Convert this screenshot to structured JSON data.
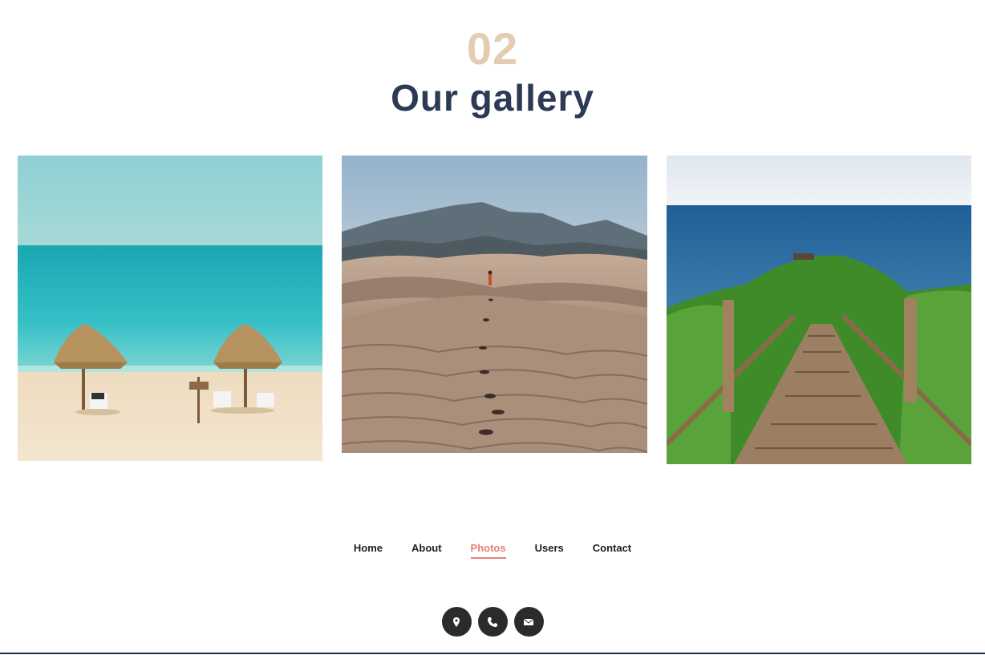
{
  "header": {
    "number": "02",
    "title": "Our gallery"
  },
  "gallery": {
    "photos": [
      {
        "subject": "beach-with-straw-umbrellas"
      },
      {
        "subject": "desert-dunes-with-hiker"
      },
      {
        "subject": "coastal-wooden-stairway"
      }
    ]
  },
  "nav": {
    "items": [
      {
        "label": "Home",
        "active": false
      },
      {
        "label": "About",
        "active": false
      },
      {
        "label": "Photos",
        "active": true
      },
      {
        "label": "Users",
        "active": false
      },
      {
        "label": "Contact",
        "active": false
      }
    ]
  },
  "social": {
    "icons": [
      "location-pin-icon",
      "phone-icon",
      "mail-icon"
    ]
  },
  "colors": {
    "number": "#e3cdb0",
    "title": "#2d3a55",
    "active_nav": "#e87f7a",
    "icon_bg": "#2b2b2b"
  }
}
